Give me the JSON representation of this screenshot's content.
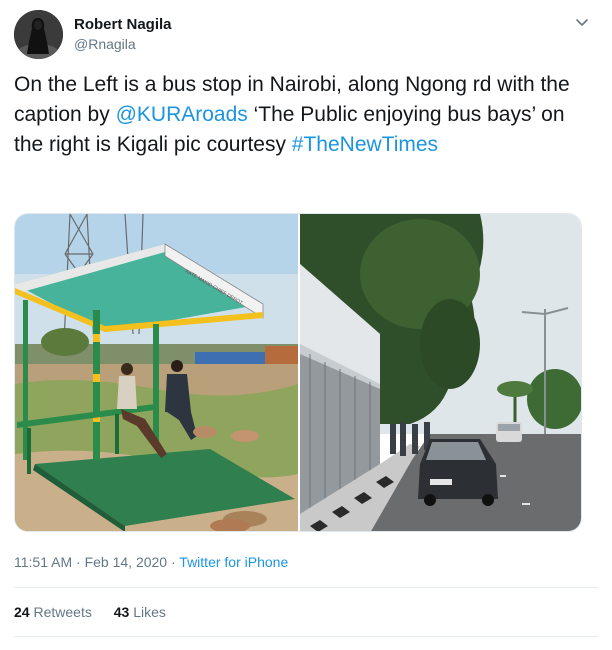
{
  "author": {
    "name": "Robert Nagila",
    "handle": "@Rnagila"
  },
  "icons": {
    "caret": "chevron-down-icon",
    "avatar": "avatar-image"
  },
  "tweet": {
    "part1": "On the Left is a bus stop in Nairobi, along Ngong rd with the caption by ",
    "mention": "@KURAroads",
    "part2": " ‘The Public enjoying bus bays’ on the right is Kigali pic courtesy ",
    "hashtag": "#TheNewTimes"
  },
  "media": {
    "left_sign_text": "KATE MAKIO CHIEF DEPOT"
  },
  "meta": {
    "time": "11:51 AM",
    "separator": " · ",
    "date": "Feb 14, 2020",
    "source": "Twitter for iPhone"
  },
  "stats": {
    "retweets_count": "24",
    "retweets_label": "Retweets",
    "likes_count": "43",
    "likes_label": "Likes"
  },
  "colors": {
    "link": "#1b95e0",
    "secondary": "#657786",
    "primary_text": "#14171a",
    "divider": "#e6ecf0"
  }
}
